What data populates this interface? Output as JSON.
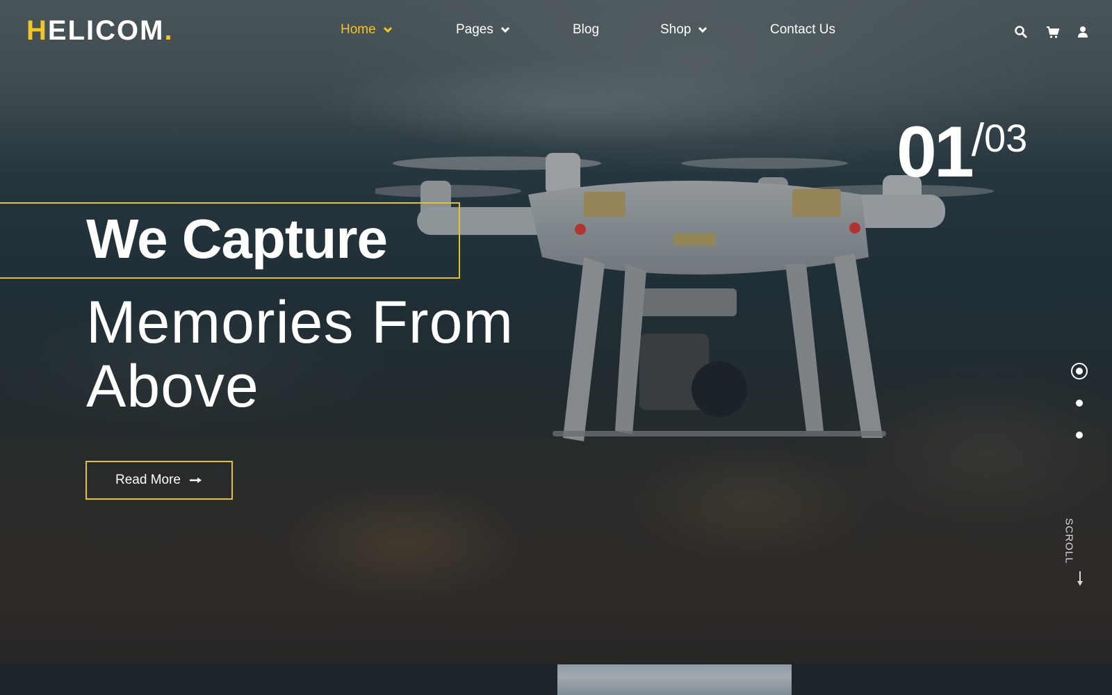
{
  "brand": {
    "logo_first": "H",
    "logo_rest": "ELICOM",
    "logo_dot": ".",
    "accent_color": "#f3c623"
  },
  "nav": {
    "items": [
      {
        "label": "Home",
        "has_dropdown": true,
        "active": true
      },
      {
        "label": "Pages",
        "has_dropdown": true,
        "active": false
      },
      {
        "label": "Blog",
        "has_dropdown": false,
        "active": false
      },
      {
        "label": "Shop",
        "has_dropdown": true,
        "active": false
      },
      {
        "label": "Contact Us",
        "has_dropdown": false,
        "active": false
      }
    ],
    "tools": [
      "search-icon",
      "cart-icon",
      "user-icon"
    ]
  },
  "hero": {
    "headline_bold": "We Capture",
    "headline_light": "Memories From Above",
    "cta_label": "Read More"
  },
  "slider": {
    "current": "01",
    "separator": "/",
    "total": "03",
    "dots": 3,
    "active_dot": 1
  },
  "scroll_label": "SCROLL"
}
